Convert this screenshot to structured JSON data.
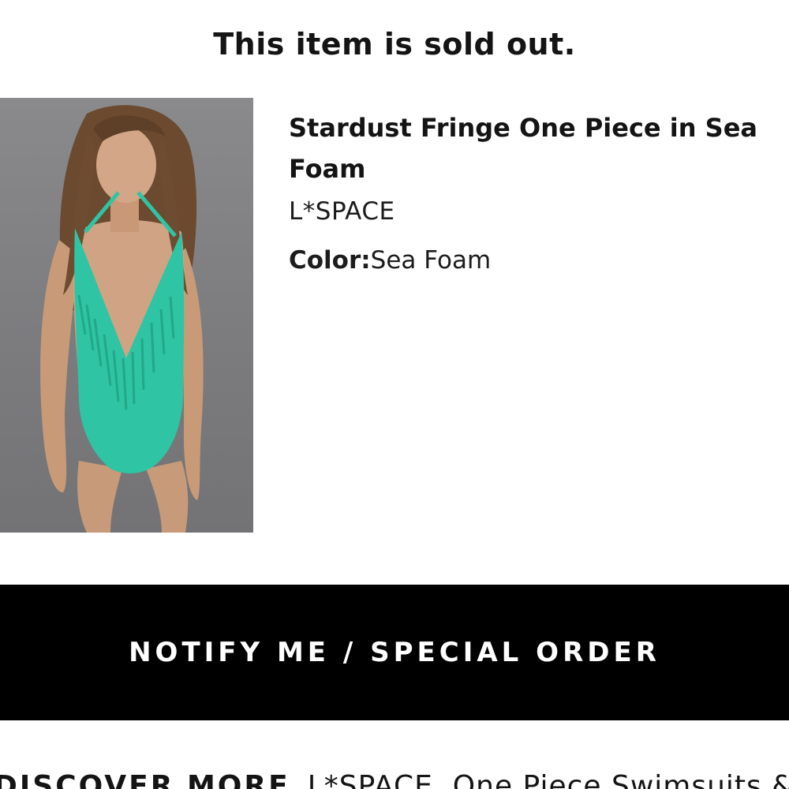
{
  "notice": {
    "sold_out_text": "This item is sold out."
  },
  "product": {
    "title": "Stardust Fringe One Piece in Sea Foam",
    "brand": "L*SPACE",
    "color_label": "Color:",
    "color_value": "Sea Foam",
    "swimsuit_color": "#2fc4a3"
  },
  "actions": {
    "notify_label": "NOTIFY ME / SPECIAL ORDER"
  },
  "discover": {
    "heading": "DISCOVER MORE",
    "link_text": "L*SPACE, One Piece Swimsuits &"
  }
}
